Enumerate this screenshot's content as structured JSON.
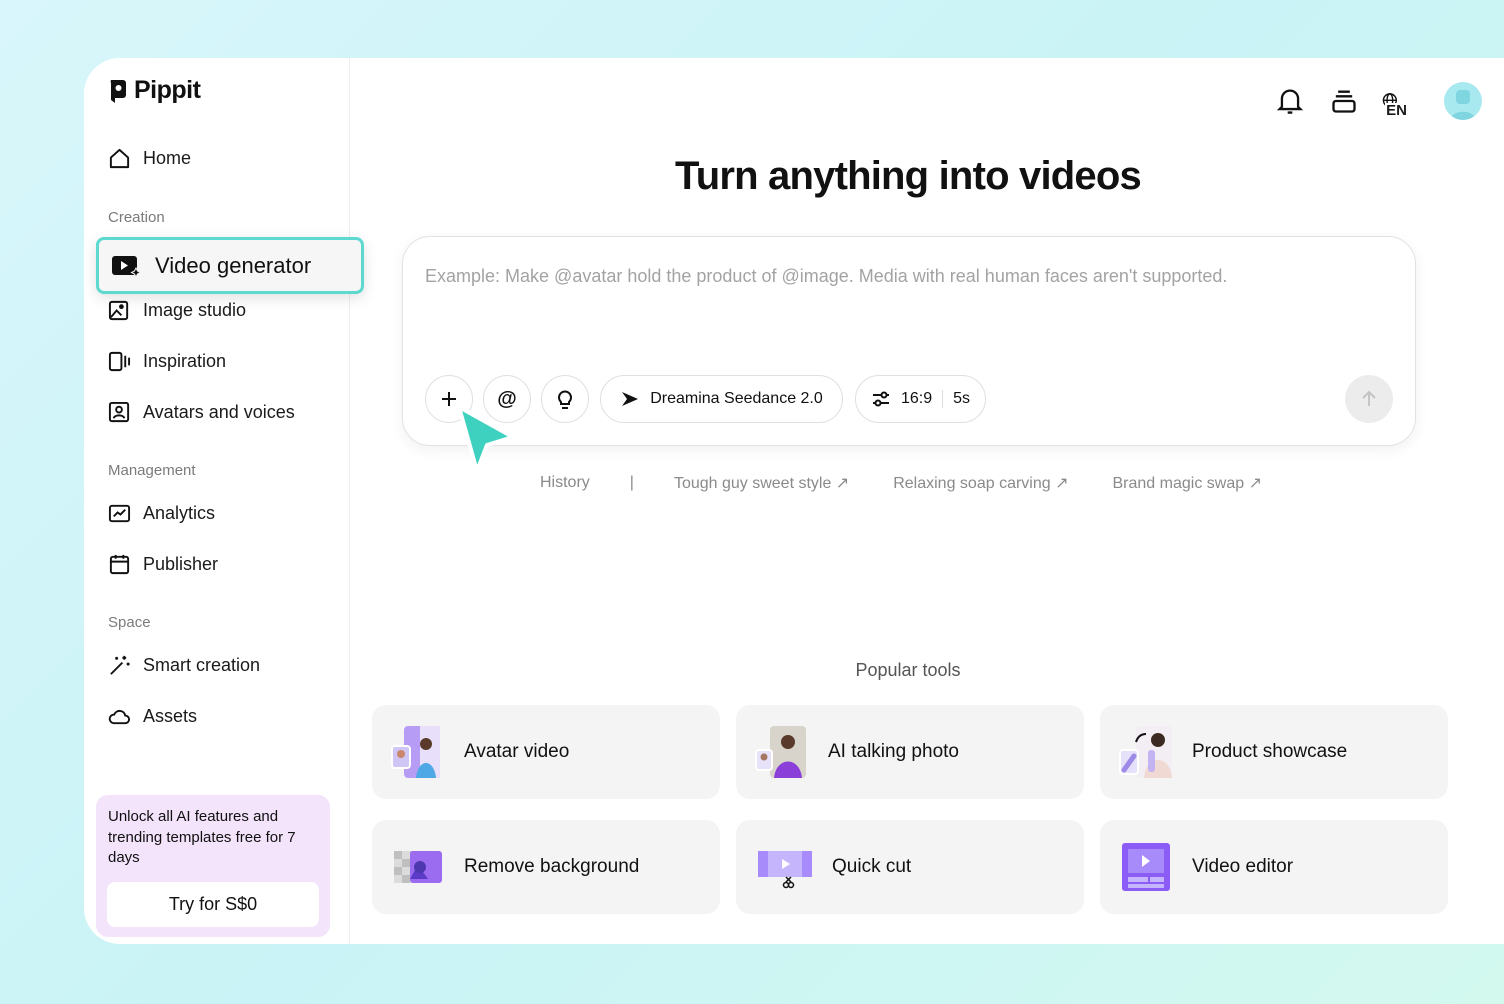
{
  "app": {
    "name": "Pippit"
  },
  "sidebar": {
    "home": "Home",
    "sections": {
      "creation": "Creation",
      "management": "Management",
      "space": "Space"
    },
    "items": {
      "video_generator": "Video generator",
      "image_studio": "Image studio",
      "inspiration": "Inspiration",
      "avatars_voices": "Avatars and voices",
      "analytics": "Analytics",
      "publisher": "Publisher",
      "smart_creation": "Smart creation",
      "assets": "Assets"
    },
    "promo": {
      "text": "Unlock all AI features and trending templates free for 7 days",
      "button": "Try for S$0"
    }
  },
  "header": {
    "language": "EN"
  },
  "main": {
    "heading": "Turn anything into videos",
    "prompt_placeholder": "Example: Make @avatar hold the product of @image. Media with real human faces aren't supported.",
    "model": "Dreamina Seedance 2.0",
    "aspect_ratio": "16:9",
    "duration": "5s",
    "suggestions": {
      "history": "History",
      "separator": "|",
      "items": [
        "Tough guy sweet style ↗",
        "Relaxing soap carving ↗",
        "Brand magic swap ↗"
      ]
    },
    "popular_title": "Popular tools",
    "tools": [
      "Avatar video",
      "AI talking photo",
      "Product showcase",
      "Remove background",
      "Quick cut",
      "Video editor"
    ]
  },
  "colors": {
    "accent": "#5ed9cf",
    "promo_bg": "#f3e3fb",
    "tool_purple": "#8b5cf6"
  }
}
